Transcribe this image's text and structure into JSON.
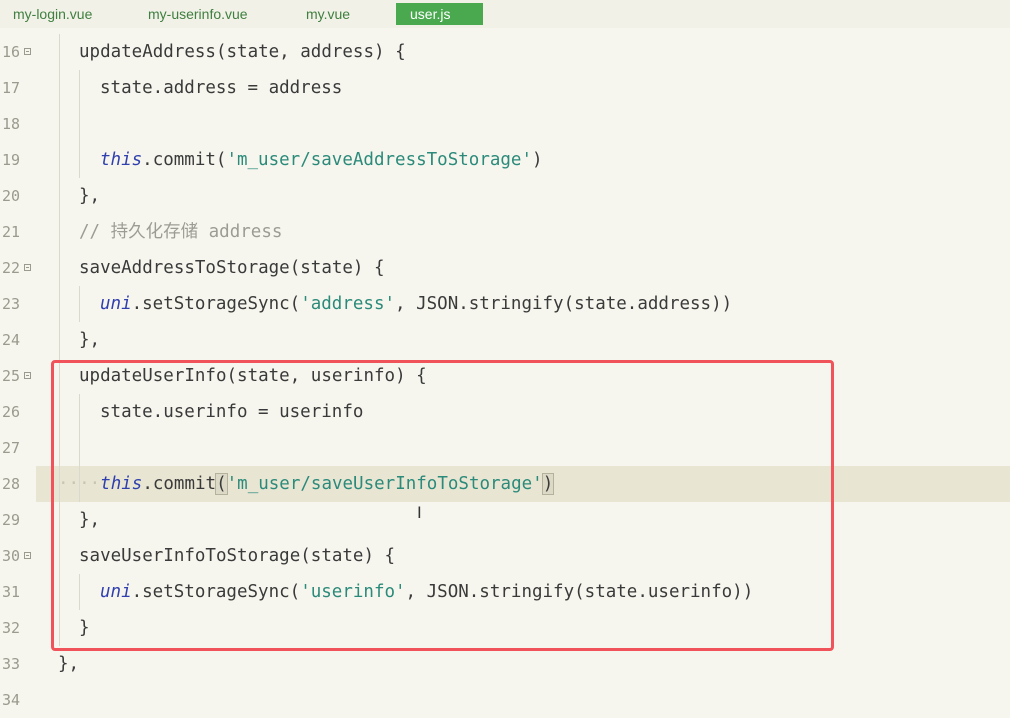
{
  "tabs": [
    {
      "label": "my-login.vue",
      "active": false
    },
    {
      "label": "my-userinfo.vue",
      "active": false
    },
    {
      "label": "my.vue",
      "active": false
    },
    {
      "label": "user.js",
      "active": true
    }
  ],
  "editor": {
    "lines": [
      {
        "num": "16",
        "fold": true,
        "indent": 1,
        "parts": [
          [
            "t",
            "updateAddress(state, address) {"
          ]
        ]
      },
      {
        "num": "17",
        "fold": false,
        "indent": 2,
        "parts": [
          [
            "t",
            "state.address = address"
          ]
        ]
      },
      {
        "num": "18",
        "fold": false,
        "indent": 2,
        "parts": []
      },
      {
        "num": "19",
        "fold": false,
        "indent": 2,
        "parts": [
          [
            "kw",
            "this"
          ],
          [
            "t",
            ".commit("
          ],
          [
            "str",
            "'m_user/saveAddressToStorage'"
          ],
          [
            "t",
            ")"
          ]
        ]
      },
      {
        "num": "20",
        "fold": false,
        "indent": 1,
        "parts": [
          [
            "t",
            "},"
          ]
        ]
      },
      {
        "num": "21",
        "fold": false,
        "indent": 1,
        "parts": [
          [
            "cm",
            "// 持久化存储 address"
          ]
        ]
      },
      {
        "num": "22",
        "fold": true,
        "indent": 1,
        "parts": [
          [
            "t",
            "saveAddressToStorage(state) {"
          ]
        ]
      },
      {
        "num": "23",
        "fold": false,
        "indent": 2,
        "parts": [
          [
            "kw",
            "uni"
          ],
          [
            "t",
            ".setStorageSync("
          ],
          [
            "str",
            "'address'"
          ],
          [
            "t",
            ", JSON.stringify(state.address))"
          ]
        ]
      },
      {
        "num": "24",
        "fold": false,
        "indent": 1,
        "parts": [
          [
            "t",
            "},"
          ]
        ]
      },
      {
        "num": "25",
        "fold": true,
        "indent": 1,
        "parts": [
          [
            "t",
            "updateUserInfo(state, userinfo) {"
          ]
        ]
      },
      {
        "num": "26",
        "fold": false,
        "indent": 2,
        "parts": [
          [
            "t",
            "state.userinfo = userinfo"
          ]
        ]
      },
      {
        "num": "27",
        "fold": false,
        "indent": 2,
        "parts": []
      },
      {
        "num": "28",
        "fold": false,
        "indent": 2,
        "current": true,
        "parts": [
          [
            "dots",
            "····"
          ],
          [
            "kw",
            "this"
          ],
          [
            "t",
            ".commit"
          ],
          [
            "bm",
            "("
          ],
          [
            "str",
            "'m_user/saveUserInfoToStorage'"
          ],
          [
            "bm",
            ")"
          ]
        ]
      },
      {
        "num": "29",
        "fold": false,
        "indent": 1,
        "parts": [
          [
            "t",
            "},"
          ]
        ]
      },
      {
        "num": "30",
        "fold": true,
        "indent": 1,
        "parts": [
          [
            "t",
            "saveUserInfoToStorage(state) {"
          ]
        ]
      },
      {
        "num": "31",
        "fold": false,
        "indent": 2,
        "parts": [
          [
            "kw",
            "uni"
          ],
          [
            "t",
            ".setStorageSync("
          ],
          [
            "str",
            "'userinfo'"
          ],
          [
            "t",
            ", JSON.stringify(state.userinfo))"
          ]
        ]
      },
      {
        "num": "32",
        "fold": false,
        "indent": 1,
        "parts": [
          [
            "t",
            "}"
          ]
        ]
      },
      {
        "num": "33",
        "fold": false,
        "indent": 0,
        "parts": [
          [
            "t",
            "},"
          ]
        ]
      },
      {
        "num": "34",
        "fold": false,
        "indent": 0,
        "parts": []
      }
    ]
  },
  "colors": {
    "background": "#f6f6ee",
    "active_tab": "#4aa84f",
    "highlight_box": "#f0535a"
  }
}
